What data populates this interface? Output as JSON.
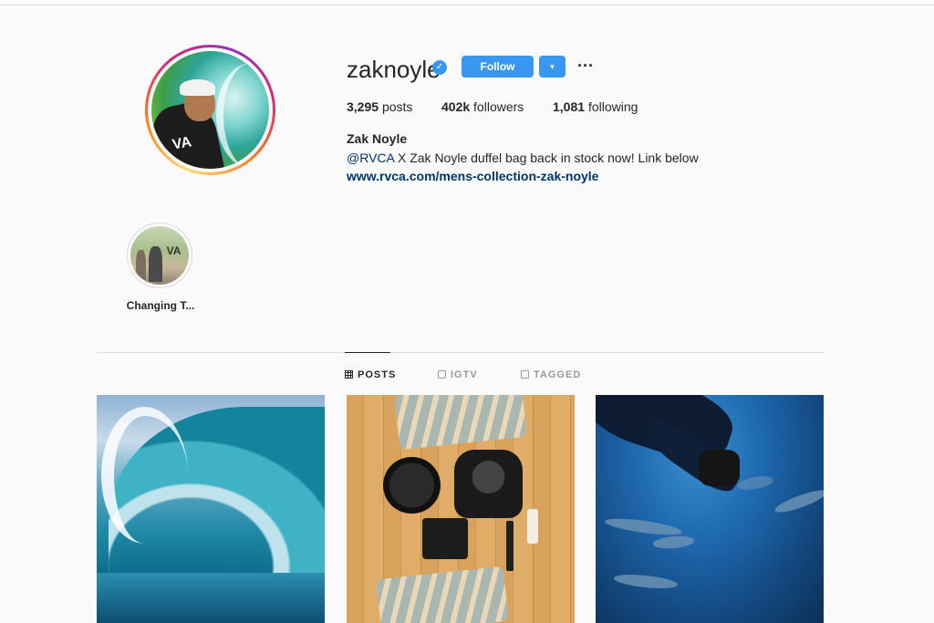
{
  "profile": {
    "username": "zaknoyle",
    "verified_icon": "verified-badge-icon",
    "follow_label": "Follow",
    "dropdown_glyph": "▾",
    "more_glyph": "···",
    "stats": {
      "posts_count": "3,295",
      "posts_label": "posts",
      "followers_count": "402k",
      "followers_label": "followers",
      "following_count": "1,081",
      "following_label": "following"
    },
    "full_name": "Zak Noyle",
    "bio_mention": "@RVCA",
    "bio_text": " X Zak Noyle duffel bag back in stock now! Link below",
    "bio_link": "www.rvca.com/mens-collection-zak-noyle"
  },
  "highlights": [
    {
      "label": "Changing T..."
    }
  ],
  "tabs": [
    {
      "label": "POSTS",
      "icon": "grid-icon",
      "active": true
    },
    {
      "label": "IGTV",
      "icon": "igtv-icon",
      "active": false
    },
    {
      "label": "TAGGED",
      "icon": "tagged-icon",
      "active": false
    }
  ],
  "posts": [
    {
      "subject": "wave"
    },
    {
      "subject": "camera-gear"
    },
    {
      "subject": "underwater-dolphins"
    }
  ],
  "colors": {
    "accent": "#3897f0",
    "link": "#003569",
    "text": "#262626",
    "muted": "#999999",
    "background": "#fafafa"
  }
}
